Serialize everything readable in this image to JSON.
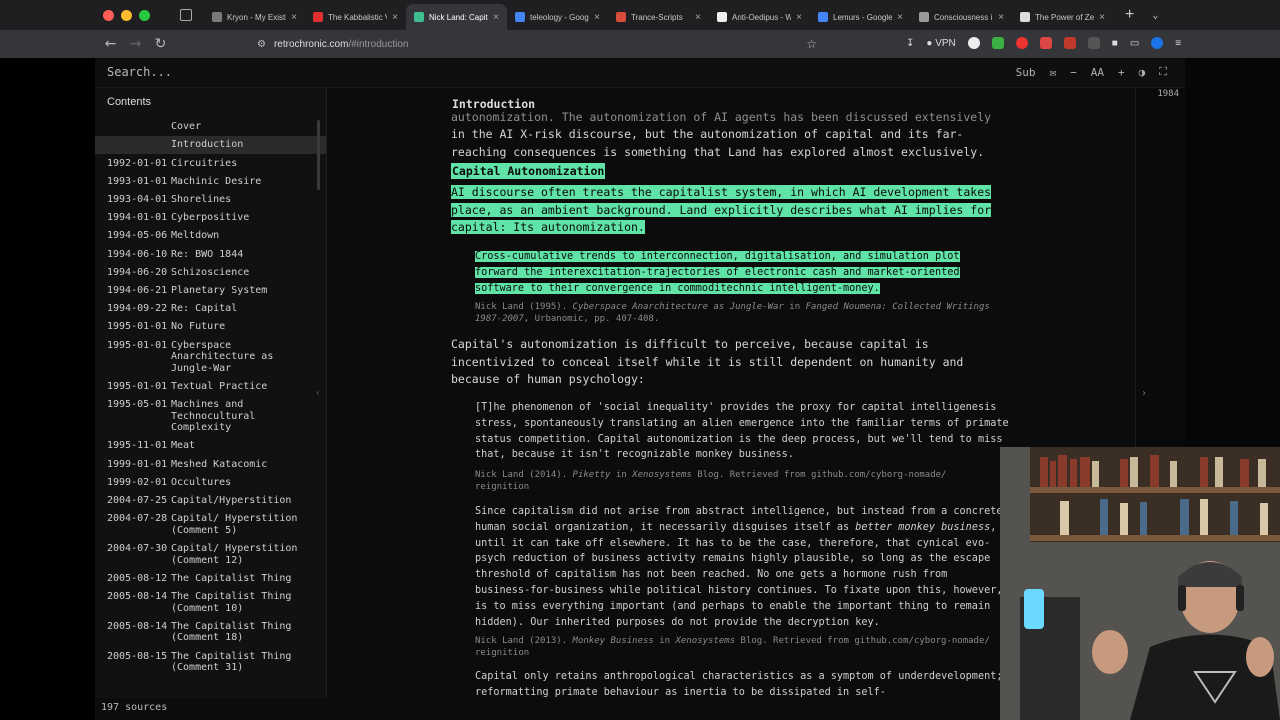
{
  "browser": {
    "tabs": [
      {
        "title": "Kryon - My Existi",
        "color": "#7a7a7a"
      },
      {
        "title": "The Kabbalistic V",
        "color": "#e03030"
      },
      {
        "title": "Nick Land: Capit",
        "color": "#3fbf8f",
        "active": true
      },
      {
        "title": "teleology - Goog",
        "color": "#4285f4"
      },
      {
        "title": "Trance-Scripts",
        "color": "#d84c3a"
      },
      {
        "title": "Anti-Oedipus - W",
        "color": "#eeeeee"
      },
      {
        "title": "Lemurs - Google",
        "color": "#4285f4"
      },
      {
        "title": "Consciousness i",
        "color": "#999999"
      },
      {
        "title": "The Power of Zero -",
        "color": "#dddddd"
      }
    ],
    "url_host": "retrochronic.com",
    "url_path": "/#introduction",
    "vpn_label": "VPN"
  },
  "app": {
    "search_placeholder": "Search...",
    "tool_sub": "Sub",
    "tool_font": "AA",
    "contents_label": "Contents",
    "sources_count": "197 sources",
    "year_badge": "1984"
  },
  "toc": [
    {
      "date": "",
      "title": "Cover"
    },
    {
      "date": "",
      "title": "Introduction",
      "active": true
    },
    {
      "date": "1992-01-01",
      "title": "Circuitries"
    },
    {
      "date": "1993-01-01",
      "title": "Machinic Desire"
    },
    {
      "date": "1993-04-01",
      "title": "Shorelines"
    },
    {
      "date": "1994-01-01",
      "title": "Cyberpositive"
    },
    {
      "date": "1994-05-06",
      "title": "Meltdown"
    },
    {
      "date": "1994-06-10",
      "title": "Re: BWO 1844"
    },
    {
      "date": "1994-06-20",
      "title": "Schizoscience"
    },
    {
      "date": "1994-06-21",
      "title": "Planetary System"
    },
    {
      "date": "1994-09-22",
      "title": "Re: Capital"
    },
    {
      "date": "1995-01-01",
      "title": "No Future"
    },
    {
      "date": "1995-01-01",
      "title": "Cyberspace Anarchitecture as Jungle-War"
    },
    {
      "date": "1995-01-01",
      "title": "Textual Practice"
    },
    {
      "date": "1995-05-01",
      "title": "Machines and Technocultural Complexity"
    },
    {
      "date": "1995-11-01",
      "title": "Meat"
    },
    {
      "date": "1999-01-01",
      "title": "Meshed Katacomic"
    },
    {
      "date": "1999-02-01",
      "title": "Occultures"
    },
    {
      "date": "2004-07-25",
      "title": "Capital/Hyperstition"
    },
    {
      "date": "2004-07-28",
      "title": "Capital/ Hyperstition (Comment 5)"
    },
    {
      "date": "2004-07-30",
      "title": "Capital/ Hyperstition (Comment 12)"
    },
    {
      "date": "2005-08-12",
      "title": "The Capitalist Thing"
    },
    {
      "date": "2005-08-14",
      "title": "The Capitalist Thing (Comment 10)"
    },
    {
      "date": "2005-08-14",
      "title": "The Capitalist Thing (Comment 18)"
    },
    {
      "date": "2005-08-15",
      "title": "The Capitalist Thing (Comment 31)"
    }
  ],
  "article": {
    "section_title": "Introduction",
    "p0_line1": "autonomization. The autonomization of AI agents has been discussed extensively",
    "p0_line2": "in the AI X-risk discourse, but the autonomization of capital and its far-",
    "p0_line3": "reaching consequences is something that Land has explored almost exclusively.",
    "heading": "Capital Autonomization",
    "p1": "AI discourse often treats the capitalist system, in which AI development takes place, as an ambient background. Land explicitly describes what AI implies for capital: Its autonomization.",
    "q1": "Cross-cumulative trends to interconnection, digitalisation, and simulation plot forward the interexcitation-trajectories of electronic cash and market-oriented software to their convergence in commoditechnic intelligent-money.",
    "c1_author": "Nick Land (1995).",
    "c1_work": "Cyberspace Anarchitecture as Jungle-War",
    "c1_in": "in",
    "c1_book": "Fanged Noumena: Collected Writings 1987-2007",
    "c1_rest": ", Urbanomic, pp. 407-408.",
    "p2": "Capital's autonomization is difficult to perceive, because capital is incentivized to conceal itself while it is still dependent on humanity and because of human psychology:",
    "q2": "[T]he phenomenon of 'social inequality' provides the proxy for capital intelligenesis stress, spontaneously translating an alien emergence into the familiar terms of primate status competition. Capital autonomization is the deep process, but we'll tend to miss that, because it isn't recognizable monkey business.",
    "c2_author": "Nick Land (2014).",
    "c2_work": "Piketty",
    "c2_in": "in",
    "c2_book": "Xenosystems",
    "c2_rest": "Blog. Retrieved from github.com/cyborg-nomade/ reignition",
    "q3_a": "Since capitalism did not arise from abstract intelligence, but instead from a concrete human social organization, it necessarily disguises itself as ",
    "q3_em": "better monkey business",
    "q3_b": ", until it can take off elsewhere. It has to be the case, therefore, that cynical evo-psych reduction of business activity remains highly plausible, so long as the escape threshold of capitalism has not been reached. No one gets a hormone rush from business-for-business while political history continues. To fixate upon this, however, is to miss everything important (and perhaps to enable the important thing to remain hidden). Our inherited purposes do not provide the decryption key.",
    "c3_author": "Nick Land (2013).",
    "c3_work": "Monkey Business",
    "c3_in": "in",
    "c3_book": "Xenosystems",
    "c3_rest": "Blog. Retrieved from github.com/cyborg-nomade/ reignition",
    "q4": "Capital only retains anthropological characteristics as a symptom of underdevelopment; reformatting primate behaviour as inertia to be dissipated in self-"
  },
  "colors": {
    "highlight": "#5fe3a6",
    "accent_tab": "#3fbf8f"
  }
}
